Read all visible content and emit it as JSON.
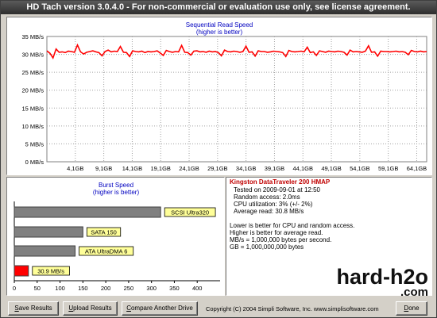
{
  "window": {
    "title": "HD Tach version 3.0.4.0  - For non-commercial or evaluation use only, see license agreement."
  },
  "read_chart": {
    "title": "Sequential Read Speed",
    "subtitle": "(higher is better)",
    "y_ticks": [
      "35 MB/s",
      "30 MB/s",
      "25 MB/s",
      "20 MB/s",
      "15 MB/s",
      "10 MB/s",
      "5 MB/s",
      "0 MB/s"
    ],
    "x_ticks": [
      "4,1GB",
      "9,1GB",
      "14,1GB",
      "19,1GB",
      "24,1GB",
      "29,1GB",
      "34,1GB",
      "39,1GB",
      "44,1GB",
      "49,1GB",
      "54,1GB",
      "59,1GB",
      "64,1GB"
    ],
    "line_color": "#ff0000"
  },
  "burst_chart": {
    "title": "Burst Speed",
    "subtitle": "(higher is better)",
    "x_ticks": [
      "0",
      "50",
      "100",
      "150",
      "200",
      "250",
      "300",
      "350",
      "400"
    ]
  },
  "info": {
    "drive_name": "Kingston DataTraveler 200 HMAP",
    "tested": "Tested on 2009-09-01 at 12:50",
    "random_access": "Random access: 2.0ms",
    "cpu": "CPU utilization: 3% (+/- 2%)",
    "average_read": "Average read: 30.8 MB/s",
    "note1": "Lower is better for CPU and random access.",
    "note2": "Higher is better for average read.",
    "note3": "MB/s = 1,000,000 bytes per second.",
    "note4": "GB = 1,000,000,000 bytes"
  },
  "logo": {
    "line1": "hard-h2o",
    "line2": ".com"
  },
  "footer": {
    "save_key": "S",
    "save_rest": "ave Results",
    "upload_key": "U",
    "upload_rest": "pload Results",
    "compare_key": "C",
    "compare_rest": "ompare Another Drive",
    "copyright": "Copyright (C) 2004 Simpli Software, Inc. www.simplisoftware.com",
    "done_key": "D",
    "done_rest": "one"
  },
  "chart_data": [
    {
      "type": "line",
      "title": "Sequential Read Speed",
      "subtitle": "(higher is better)",
      "xlabel": "",
      "ylabel": "",
      "y_unit": "MB/s",
      "ylim": [
        0,
        35
      ],
      "x_tick_labels": [
        "4,1GB",
        "9,1GB",
        "14,1GB",
        "19,1GB",
        "24,1GB",
        "29,1GB",
        "34,1GB",
        "39,1GB",
        "44,1GB",
        "49,1GB",
        "54,1GB",
        "59,1GB",
        "64,1GB"
      ],
      "grid": true,
      "series": [
        {
          "color": "#ff0000",
          "values": [
            31.0,
            30.3,
            29.0,
            31.5,
            30.6,
            30.7,
            30.5,
            30.9,
            30.8,
            30.6,
            32.6,
            30.7,
            30.1,
            30.6,
            30.8,
            31.0,
            30.7,
            30.5,
            29.6,
            30.8,
            31.2,
            30.7,
            30.9,
            30.8,
            32.2,
            30.6,
            30.5,
            29.4,
            31.0,
            30.8,
            30.7,
            30.9,
            30.5,
            30.8,
            30.7,
            30.8,
            31.0,
            30.4,
            29.7,
            31.1,
            30.8,
            30.6,
            30.8,
            30.7,
            32.5,
            30.6,
            30.5,
            29.8,
            30.9,
            31.0,
            30.7,
            30.8,
            30.6,
            30.9,
            30.7,
            30.8,
            30.5,
            29.6,
            31.2,
            30.8,
            30.7,
            30.9,
            30.8,
            30.6,
            30.8,
            32.3,
            30.6,
            30.7,
            29.5,
            31.0,
            30.8,
            30.8,
            30.6,
            30.7,
            30.9,
            30.8,
            30.7,
            30.5,
            29.4,
            31.1,
            30.8,
            30.7,
            30.8,
            30.9,
            30.7,
            32.0,
            30.5,
            30.7,
            29.7,
            31.0,
            30.8,
            30.6,
            30.9,
            30.8,
            30.7,
            30.9,
            30.8,
            30.6,
            29.8,
            31.2,
            30.7,
            30.8,
            30.7,
            30.6,
            30.9,
            32.4,
            30.6,
            30.7,
            29.5,
            30.9,
            30.8,
            30.8,
            30.7,
            30.8,
            30.9,
            30.7,
            30.8,
            30.6,
            29.9,
            31.1,
            30.8,
            30.7,
            30.9,
            30.7,
            30.8
          ]
        }
      ]
    },
    {
      "type": "bar",
      "orientation": "horizontal",
      "title": "Burst Speed",
      "subtitle": "(higher is better)",
      "xlim": [
        0,
        450
      ],
      "x_tick_labels": [
        "0",
        "50",
        "100",
        "150",
        "200",
        "250",
        "300",
        "350",
        "400"
      ],
      "grid": false,
      "bars": [
        {
          "label": "SCSI Ultra320",
          "value": 320,
          "color": "#808080"
        },
        {
          "label": "SATA 150",
          "value": 150,
          "color": "#808080"
        },
        {
          "label": "ATA UltraDMA 6",
          "value": 133,
          "color": "#808080"
        },
        {
          "label": "30.9 MB/s",
          "value": 30.9,
          "color": "#ff0000"
        }
      ]
    }
  ]
}
